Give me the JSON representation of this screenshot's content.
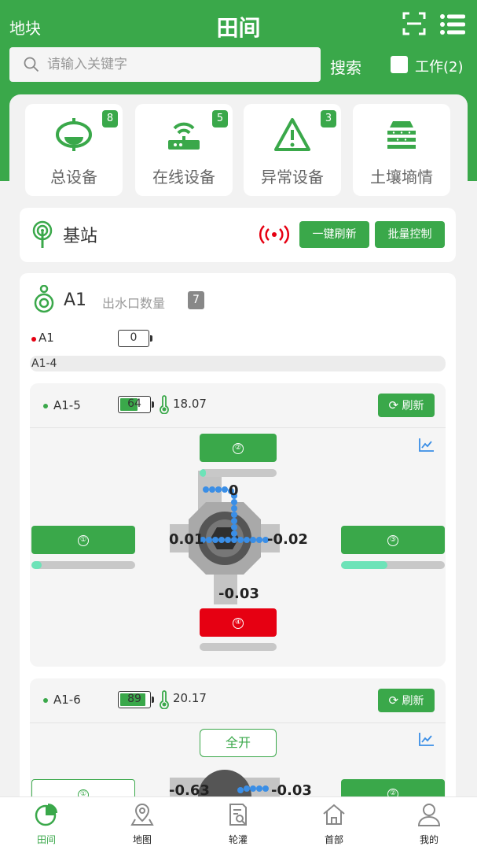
{
  "header": {
    "left": "地块",
    "title": "田间",
    "search_placeholder": "请输入关键字",
    "search_label": "搜索",
    "work_label": "工作(2)"
  },
  "stats": [
    {
      "label": "总设备",
      "badge": "8"
    },
    {
      "label": "在线设备",
      "badge": "5"
    },
    {
      "label": "异常设备",
      "badge": "3"
    },
    {
      "label": "土壤墒情",
      "badge": ""
    }
  ],
  "base_station": {
    "title": "基站",
    "refresh_all": "一键刷新",
    "batch_control": "批量控制"
  },
  "group": {
    "name": "A1",
    "outlet_label": "出水口数量",
    "outlet_count": "7",
    "device": {
      "name": "A1",
      "battery": "0"
    },
    "sub_name": "A1-4"
  },
  "units": [
    {
      "name": "A1-5",
      "battery": "64",
      "battery_level": 64,
      "temperature": "18.07",
      "refresh": "刷新",
      "outlets": [
        {
          "num": "①",
          "progress": 10
        },
        {
          "num": "②",
          "progress": 8
        },
        {
          "num": "③",
          "progress": 45
        },
        {
          "num": "④",
          "progress": 0
        }
      ],
      "flows": {
        "top": "0",
        "left": "0.01",
        "right": "-0.02",
        "bottom": "-0.03"
      }
    },
    {
      "name": "A1-6",
      "battery": "89",
      "battery_level": 89,
      "temperature": "20.17",
      "refresh": "刷新",
      "open_all": "全开",
      "outlets": [
        {
          "num": "①"
        },
        {
          "num": "②"
        }
      ],
      "flows": {
        "left": "-0.63",
        "right": "-0.03"
      }
    }
  ],
  "tabs": [
    {
      "label": "田间",
      "active": true
    },
    {
      "label": "地图"
    },
    {
      "label": "轮灌"
    },
    {
      "label": "首部"
    },
    {
      "label": "我的"
    }
  ],
  "colors": {
    "primary": "#3aa84a",
    "danger": "#e60012",
    "progress": "#6de3b8",
    "link": "#3a8ee6"
  }
}
